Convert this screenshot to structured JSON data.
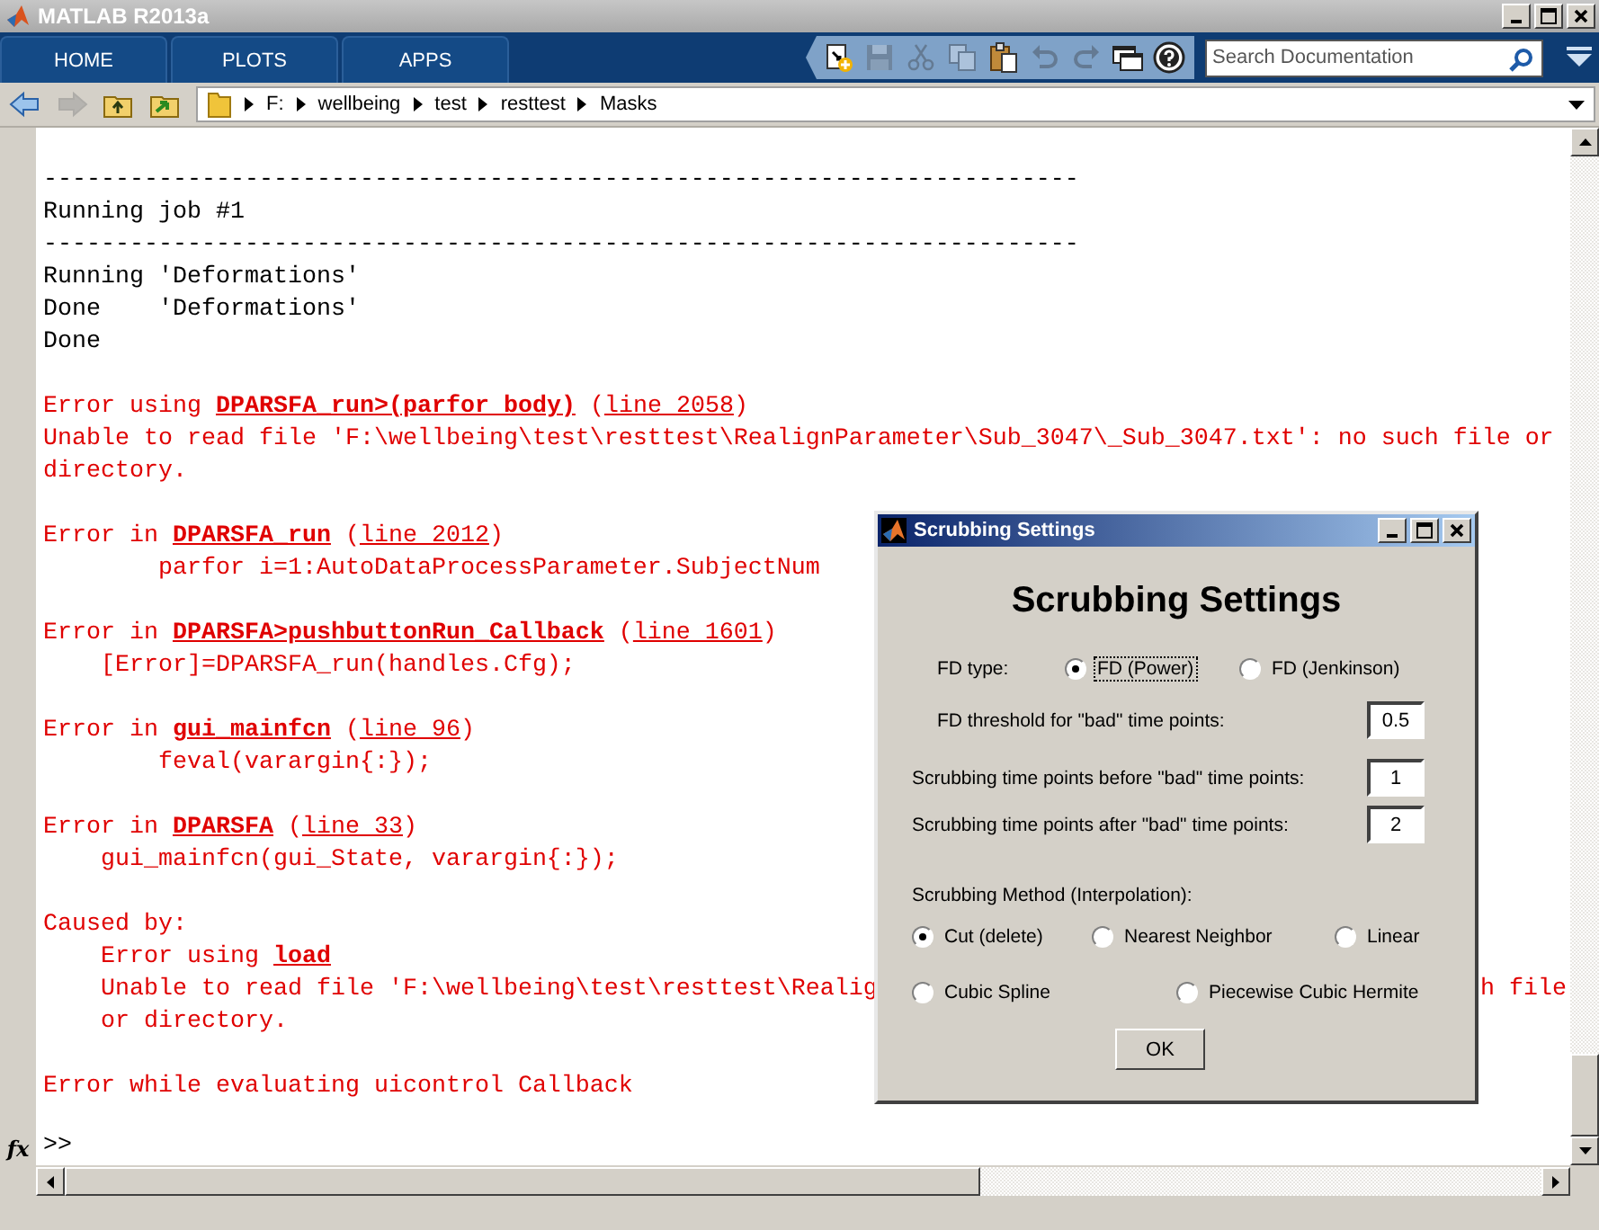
{
  "window": {
    "title": "MATLAB R2013a"
  },
  "tabs": [
    {
      "label": "HOME"
    },
    {
      "label": "PLOTS"
    },
    {
      "label": "APPS"
    }
  ],
  "toolbar": [
    {
      "kind": "new",
      "disabled": false
    },
    {
      "kind": "save",
      "disabled": true
    },
    {
      "kind": "cut",
      "disabled": true
    },
    {
      "kind": "copy",
      "disabled": true
    },
    {
      "kind": "paste",
      "disabled": false
    },
    {
      "kind": "undo",
      "disabled": true
    },
    {
      "kind": "redo",
      "disabled": true
    },
    {
      "kind": "windows",
      "disabled": false
    },
    {
      "kind": "help",
      "disabled": false
    }
  ],
  "search": {
    "placeholder": "Search Documentation"
  },
  "nav_buttons": [
    {
      "kind": "back",
      "disabled": false
    },
    {
      "kind": "forward",
      "disabled": true
    },
    {
      "kind": "up",
      "disabled": false
    },
    {
      "kind": "browse",
      "disabled": false
    }
  ],
  "path": [
    "F:",
    "wellbeing",
    "test",
    "resttest",
    "Masks"
  ],
  "console": {
    "blocks": [
      [
        {
          "kind": "output",
          "segments": [
            {
              "kind": "plain",
              "text": "------------------------------------------------------------------------"
            }
          ]
        },
        {
          "kind": "output",
          "segments": [
            {
              "kind": "plain",
              "text": "Running job #1"
            }
          ]
        },
        {
          "kind": "output",
          "segments": [
            {
              "kind": "plain",
              "text": "------------------------------------------------------------------------"
            }
          ]
        },
        {
          "kind": "output",
          "segments": [
            {
              "kind": "plain",
              "text": "Running 'Deformations'"
            }
          ]
        },
        {
          "kind": "output",
          "segments": [
            {
              "kind": "plain",
              "text": "Done    'Deformations'"
            }
          ]
        },
        {
          "kind": "output",
          "segments": [
            {
              "kind": "plain",
              "text": "Done"
            }
          ]
        }
      ],
      [
        {
          "kind": "error",
          "segments": [
            {
              "kind": "plain",
              "text": "Error using "
            },
            {
              "kind": "strong-link",
              "text": "DPARSFA_run>(parfor body)"
            },
            {
              "kind": "plain",
              "text": " ("
            },
            {
              "kind": "link",
              "text": "line 2058"
            },
            {
              "kind": "plain",
              "text": ")"
            }
          ]
        },
        {
          "kind": "error",
          "segments": [
            {
              "kind": "plain",
              "text": "Unable to read file 'F:\\wellbeing\\test\\resttest\\RealignParameter\\Sub_3047\\_Sub_3047.txt': no such file or"
            }
          ]
        },
        {
          "kind": "error",
          "segments": [
            {
              "kind": "plain",
              "text": "directory."
            }
          ]
        }
      ],
      [
        {
          "kind": "error",
          "segments": [
            {
              "kind": "plain",
              "text": "Error in "
            },
            {
              "kind": "strong-link",
              "text": "DPARSFA_run"
            },
            {
              "kind": "plain",
              "text": " ("
            },
            {
              "kind": "link",
              "text": "line 2012"
            },
            {
              "kind": "plain",
              "text": ")"
            }
          ]
        },
        {
          "kind": "error",
          "segments": [
            {
              "kind": "plain",
              "text": "        parfor i=1:AutoDataProcessParameter.SubjectNum"
            }
          ]
        }
      ],
      [
        {
          "kind": "error",
          "segments": [
            {
              "kind": "plain",
              "text": "Error in "
            },
            {
              "kind": "strong-link",
              "text": "DPARSFA>pushbuttonRun_Callback"
            },
            {
              "kind": "plain",
              "text": " ("
            },
            {
              "kind": "link",
              "text": "line 1601"
            },
            {
              "kind": "plain",
              "text": ")"
            }
          ]
        },
        {
          "kind": "error",
          "segments": [
            {
              "kind": "plain",
              "text": "    [Error]=DPARSFA_run(handles.Cfg);"
            }
          ]
        }
      ],
      [
        {
          "kind": "error",
          "segments": [
            {
              "kind": "plain",
              "text": "Error in "
            },
            {
              "kind": "strong-link",
              "text": "gui_mainfcn"
            },
            {
              "kind": "plain",
              "text": " ("
            },
            {
              "kind": "link",
              "text": "line 96"
            },
            {
              "kind": "plain",
              "text": ")"
            }
          ]
        },
        {
          "kind": "error",
          "segments": [
            {
              "kind": "plain",
              "text": "        feval(varargin{:});"
            }
          ]
        }
      ],
      [
        {
          "kind": "error",
          "segments": [
            {
              "kind": "plain",
              "text": "Error in "
            },
            {
              "kind": "strong-link",
              "text": "DPARSFA"
            },
            {
              "kind": "plain",
              "text": " ("
            },
            {
              "kind": "link",
              "text": "line 33"
            },
            {
              "kind": "plain",
              "text": ")"
            }
          ]
        },
        {
          "kind": "error",
          "segments": [
            {
              "kind": "plain",
              "text": "    gui_mainfcn(gui_State, varargin{:});"
            }
          ]
        }
      ],
      [
        {
          "kind": "error",
          "segments": [
            {
              "kind": "plain",
              "text": "Caused by:"
            }
          ]
        },
        {
          "kind": "error",
          "segments": [
            {
              "kind": "plain",
              "text": "    Error using "
            },
            {
              "kind": "strong-link",
              "text": "load"
            }
          ]
        },
        {
          "kind": "error",
          "segments": [
            {
              "kind": "plain",
              "text": "    Unable to read file 'F:\\wellbeing\\test\\resttest\\Realig"
            }
          ],
          "fragment": "h file"
        },
        {
          "kind": "error",
          "segments": [
            {
              "kind": "plain",
              "text": "    or directory."
            }
          ]
        }
      ],
      [
        {
          "kind": "error",
          "segments": [
            {
              "kind": "plain",
              "text": "Error while evaluating uicontrol Callback"
            }
          ]
        }
      ]
    ],
    "prompt_icon": "fx",
    "prompt": ">>"
  },
  "dialog": {
    "title": "Scrubbing Settings",
    "heading": "Scrubbing Settings",
    "fd_type": {
      "label": "FD type:",
      "options": [
        {
          "label": "FD (Power)",
          "selected": true,
          "focused": true
        },
        {
          "label": "FD (Jenkinson)",
          "selected": false,
          "focused": false
        }
      ]
    },
    "fields": [
      {
        "label": "FD threshold for \"bad\" time points:",
        "value": "0.5"
      },
      {
        "label": "Scrubbing time points before \"bad\" time points:",
        "value": "1"
      },
      {
        "label": "Scrubbing time points after \"bad\" time points:",
        "value": "2"
      }
    ],
    "method": {
      "label": "Scrubbing Method (Interpolation):",
      "options": [
        {
          "label": "Cut (delete)",
          "selected": true
        },
        {
          "label": "Nearest Neighbor",
          "selected": false
        },
        {
          "label": "Linear",
          "selected": false
        },
        {
          "label": "Cubic Spline",
          "selected": false
        },
        {
          "label": "Piecewise Cubic Hermite",
          "selected": false
        }
      ]
    },
    "ok": "OK"
  }
}
